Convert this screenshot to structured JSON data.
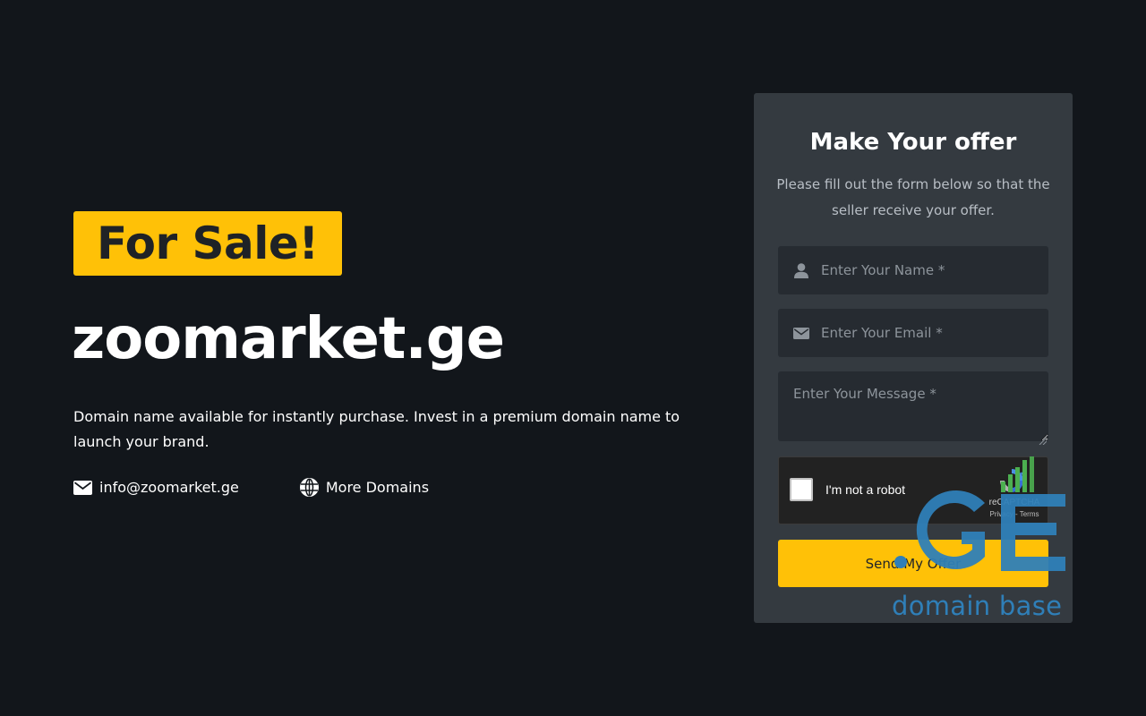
{
  "hero": {
    "badge": "For Sale!",
    "domain": "zoomarket.ge",
    "description": "Domain name available for instantly purchase. Invest in a premium domain name to launch your brand.",
    "email_icon": "envelope-icon",
    "email": "info@zoomarket.ge",
    "more_icon": "globe-icon",
    "more_label": "More Domains"
  },
  "form": {
    "title": "Make Your offer",
    "subtitle": "Please fill out the form below so that the seller receive your offer.",
    "name_icon": "user-icon",
    "name_placeholder": "Enter Your Name *",
    "email_icon": "envelope-icon",
    "email_placeholder": "Enter Your Email *",
    "message_placeholder": "Enter Your Message *",
    "captcha": {
      "label": "I'm not a robot",
      "brand": "reCAPTCHA",
      "links": "Privacy - Terms"
    },
    "submit_label": "Send My Offer"
  },
  "watermark": {
    "text": "domain base"
  },
  "colors": {
    "background": "#12161b",
    "accent": "#ffc107",
    "card": "#343a40",
    "input": "#262b31",
    "watermark_blue": "#2f7fb8",
    "watermark_green": "#4caf50"
  }
}
